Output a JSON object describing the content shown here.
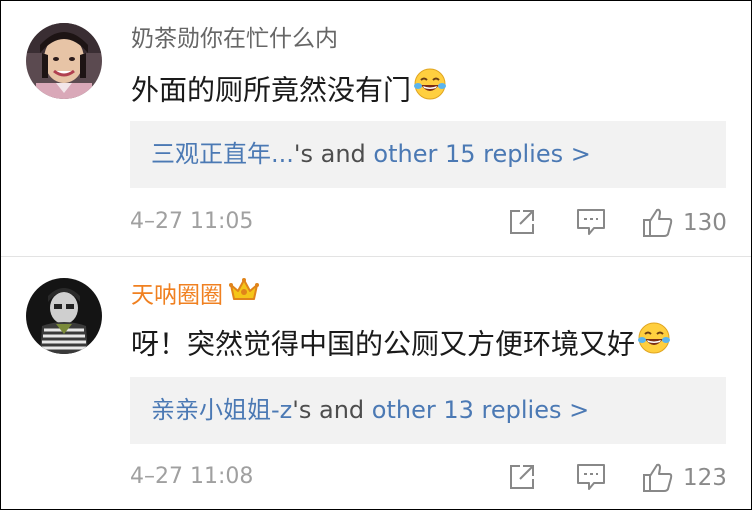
{
  "comments": [
    {
      "username": "奶茶勋你在忙什么内",
      "text": "外面的厕所竟然没有门",
      "replies": {
        "first_replier": "三观正直年...",
        "possessive": "'s and ",
        "other_link": "other 15 replies >"
      },
      "timestamp": "4–27 11:05",
      "likes": "130"
    },
    {
      "username": "天呐圈圈",
      "text": "呀！突然觉得中国的公厕又方便环境又好",
      "replies": {
        "first_replier": "亲亲小姐姐-z",
        "possessive": "'s and ",
        "other_link": "other 13 replies >"
      },
      "timestamp": "4–27 11:08",
      "likes": "123"
    }
  ],
  "icons": {
    "laugh_emoji": "laughing-crying-face",
    "badge": "crown-badge",
    "share": "share-icon",
    "reply": "comment-icon",
    "like": "thumbs-up-icon"
  },
  "colors": {
    "username_plain": "#666666",
    "username_highlight": "#f08020",
    "link": "#4b79b4",
    "meta": "#a0a0a0",
    "reply_box_bg": "#f2f2f2"
  }
}
